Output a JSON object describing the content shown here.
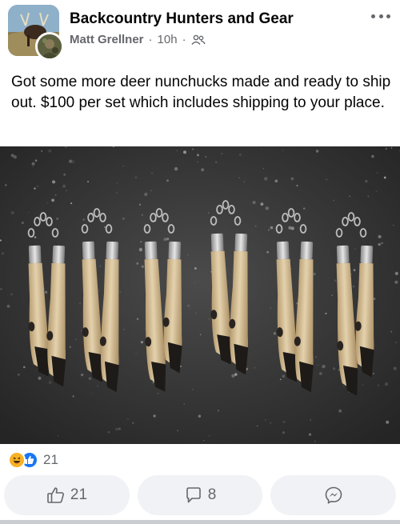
{
  "post": {
    "group_name": "Backcountry Hunters and Gear",
    "author": "Matt Grellner",
    "time": "10h",
    "separator": "·",
    "privacy_icon": "members-icon",
    "body": "Got some more deer nunchucks made and ready to ship out. $100 per set which includes shipping to your place."
  },
  "reactions": {
    "icons": [
      "haha-icon",
      "like-icon"
    ],
    "count": "21"
  },
  "actions": {
    "like_count": "21",
    "comment_count": "8",
    "share_icon": "messenger-icon"
  },
  "colors": {
    "text_primary": "#050505",
    "text_secondary": "#65676b",
    "button_bg": "#f0f2f5",
    "like_blue": "#1877f2",
    "haha_yellow": "#f7b125"
  }
}
